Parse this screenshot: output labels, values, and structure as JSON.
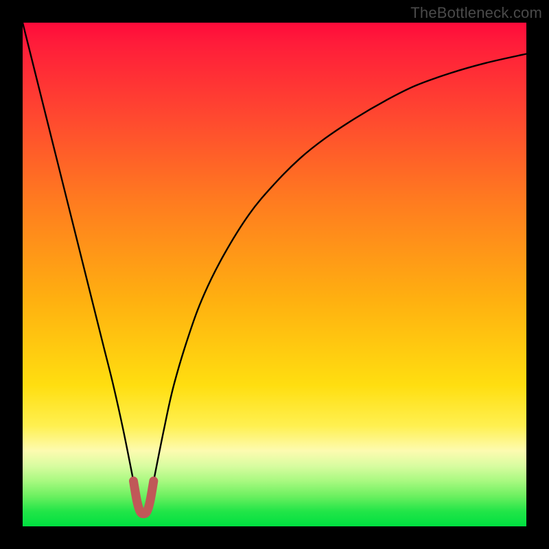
{
  "watermark": "TheBottleneck.com",
  "chart_data": {
    "type": "line",
    "title": "",
    "xlabel": "",
    "ylabel": "",
    "xlim": [
      0,
      100
    ],
    "ylim": [
      0,
      100
    ],
    "series": [
      {
        "name": "bottleneck-curve",
        "x": [
          0,
          2,
          4,
          6,
          8,
          10,
          12,
          14,
          16,
          18,
          20,
          22,
          23,
          23.5,
          24,
          25,
          26,
          28,
          30,
          33,
          36,
          40,
          45,
          50,
          55,
          60,
          66,
          72,
          78,
          85,
          92,
          100
        ],
        "y": [
          100,
          92,
          84,
          76,
          68,
          60,
          52,
          44,
          36,
          28,
          19,
          9,
          4,
          2.5,
          2.5,
          4,
          9,
          19,
          28,
          38,
          46,
          54,
          62,
          68,
          73,
          77,
          81,
          84.5,
          87.5,
          90,
          92,
          93.8
        ]
      },
      {
        "name": "highlight-u",
        "x": [
          22,
          22.7,
          23.3,
          24,
          24.7,
          25.3,
          26
        ],
        "y": [
          9,
          5,
          3,
          2.5,
          3,
          5,
          9
        ]
      }
    ],
    "colors": {
      "curve": "#000000",
      "highlight": "#c05858",
      "gradient_top": "#ff0a3a",
      "gradient_mid": "#ffde10",
      "gradient_bottom": "#00e040",
      "frame": "#000000"
    }
  }
}
